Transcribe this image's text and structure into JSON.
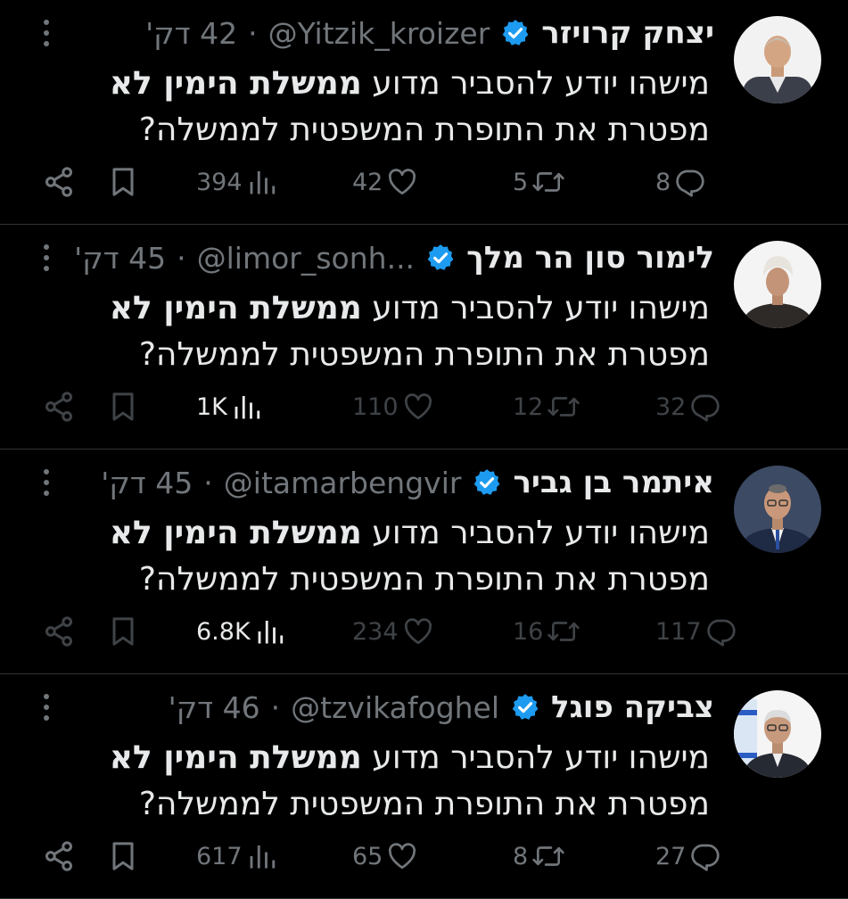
{
  "tweets": [
    {
      "name": "יצחק קרויזר",
      "handle": "@Yitzik_kroizer",
      "time": "42 דק'",
      "text_plain_1": "מישהו יודע להסביר מדוע ",
      "text_bold": "ממשלת הימין לא",
      "text_line2": "מפטרת את התופרת המשפטית לממשלה?",
      "views": "394",
      "likes": "42",
      "retweets": "5",
      "replies": "8",
      "dim": false
    },
    {
      "name": "לימור סון הר מלך",
      "handle": "@limor_sonh...",
      "time": "45 דק'",
      "text_plain_1": "מישהו יודע להסביר מדוע ",
      "text_bold": "ממשלת הימין לא",
      "text_line2": "מפטרת את התופרת המשפטית לממשלה?",
      "views": "1K",
      "likes": "110",
      "retweets": "12",
      "replies": "32",
      "dim": true
    },
    {
      "name": "איתמר בן גביר",
      "handle": "@itamarbengvir",
      "time": "45 דק'",
      "text_plain_1": "מישהו יודע להסביר מדוע ",
      "text_bold": "ממשלת הימין לא",
      "text_line2": "מפטרת את התופרת המשפטית לממשלה?",
      "views": "6.8K",
      "likes": "234",
      "retweets": "16",
      "replies": "117",
      "dim": true
    },
    {
      "name": "צביקה פוגל",
      "handle": "@tzvikafoghel",
      "time": "46 דק'",
      "text_plain_1": "מישהו יודע להסביר מדוע ",
      "text_bold": "ממשלת הימין לא",
      "text_line2": "מפטרת את התופרת המשפטית לממשלה?",
      "views": "617",
      "likes": "65",
      "retweets": "8",
      "replies": "27",
      "dim": false
    }
  ],
  "separator": "·",
  "colors": {
    "background": "#000000",
    "text": "#e7e9ea",
    "muted": "#71767b",
    "verified": "#1d9bf0",
    "divider": "#2f3336"
  },
  "icons": {
    "verified": "verified-badge-icon",
    "more": "more-dots-icon",
    "share": "share-icon",
    "bookmark": "bookmark-icon",
    "views": "views-icon",
    "like": "heart-icon",
    "retweet": "retweet-icon",
    "reply": "reply-icon"
  }
}
